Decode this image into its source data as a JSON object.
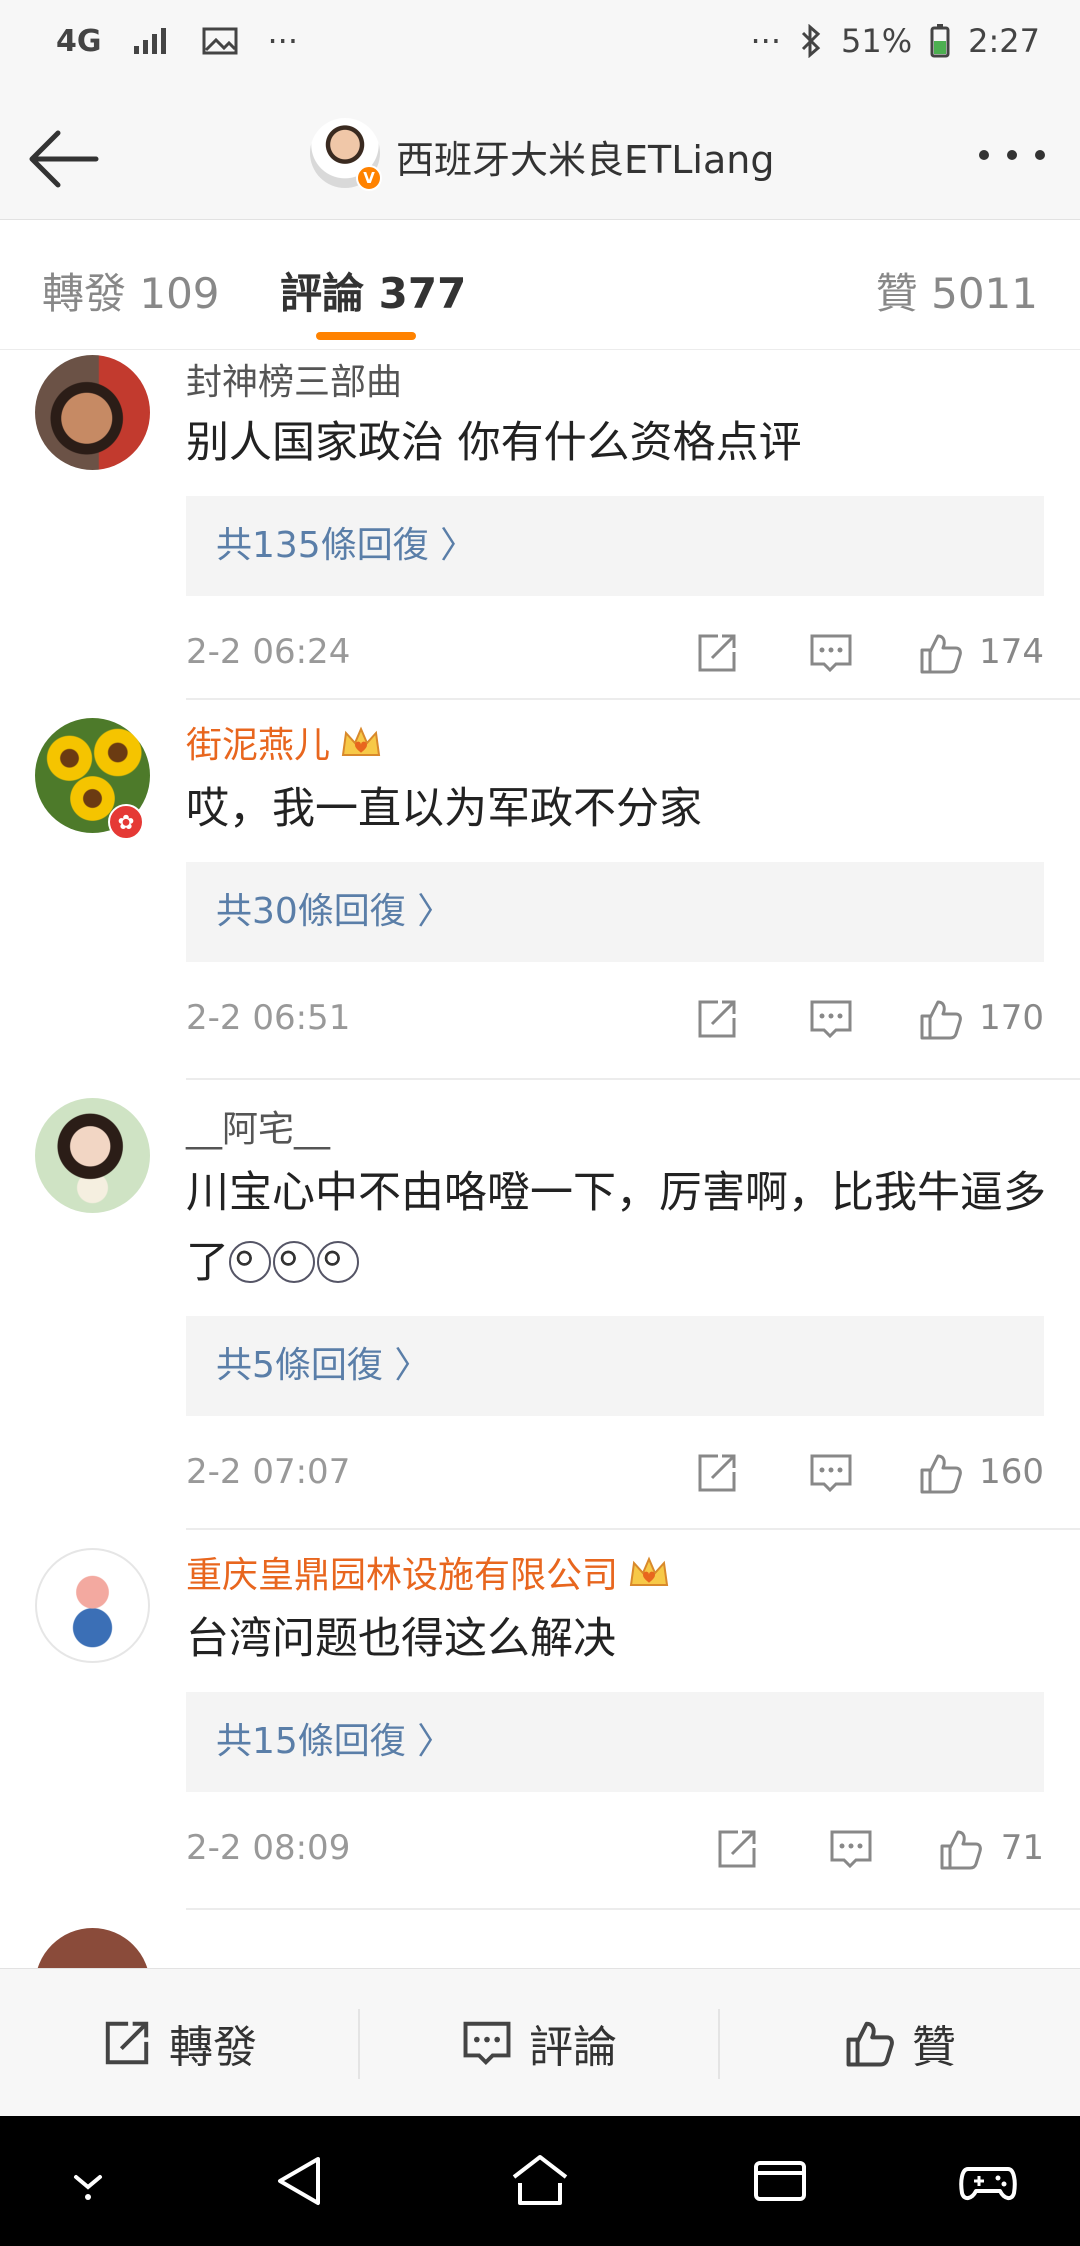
{
  "status": {
    "network": "4G",
    "battery": "51%",
    "time": "2:27",
    "overflow": "···"
  },
  "header": {
    "title": "西班牙大米良ETLiang",
    "badge": "V"
  },
  "tabs": [
    {
      "label": "轉發 109"
    },
    {
      "label": "評論 377"
    },
    {
      "label": "贊 5011"
    }
  ],
  "comments": [
    {
      "user": "封神榜三部曲",
      "text": "别人国家政治 你有什么资格点评",
      "replies": "共135條回復 〉",
      "time": "2-2 06:24",
      "likes": "174"
    },
    {
      "user": "街泥燕儿",
      "text": "哎，我一直以为军政不分家",
      "replies": "共30條回復 〉",
      "time": "2-2 06:51",
      "likes": "170"
    },
    {
      "user": "__阿宅__",
      "text": "川宝心中不由咯噔一下，厉害啊，比我牛逼多了",
      "replies": "共5條回復 〉",
      "time": "2-2 07:07",
      "likes": "160"
    },
    {
      "user": "重庆皇鼎园林设施有限公司",
      "text": "台湾问题也得这么解决",
      "replies": "共15條回復 〉",
      "time": "2-2 08:09",
      "likes": "71"
    }
  ],
  "toolbar": {
    "repost": "轉發",
    "comment": "評論",
    "like": "贊"
  },
  "colors": {
    "accent": "#ff8200",
    "vip_name": "#e8661e",
    "link": "#5a7ea8"
  },
  "icons": [
    "back-arrow-icon",
    "more-icon",
    "share-icon",
    "comment-icon",
    "thumbs-up-icon",
    "crown-icon",
    "home-icon",
    "recent-apps-icon",
    "game-icon"
  ]
}
